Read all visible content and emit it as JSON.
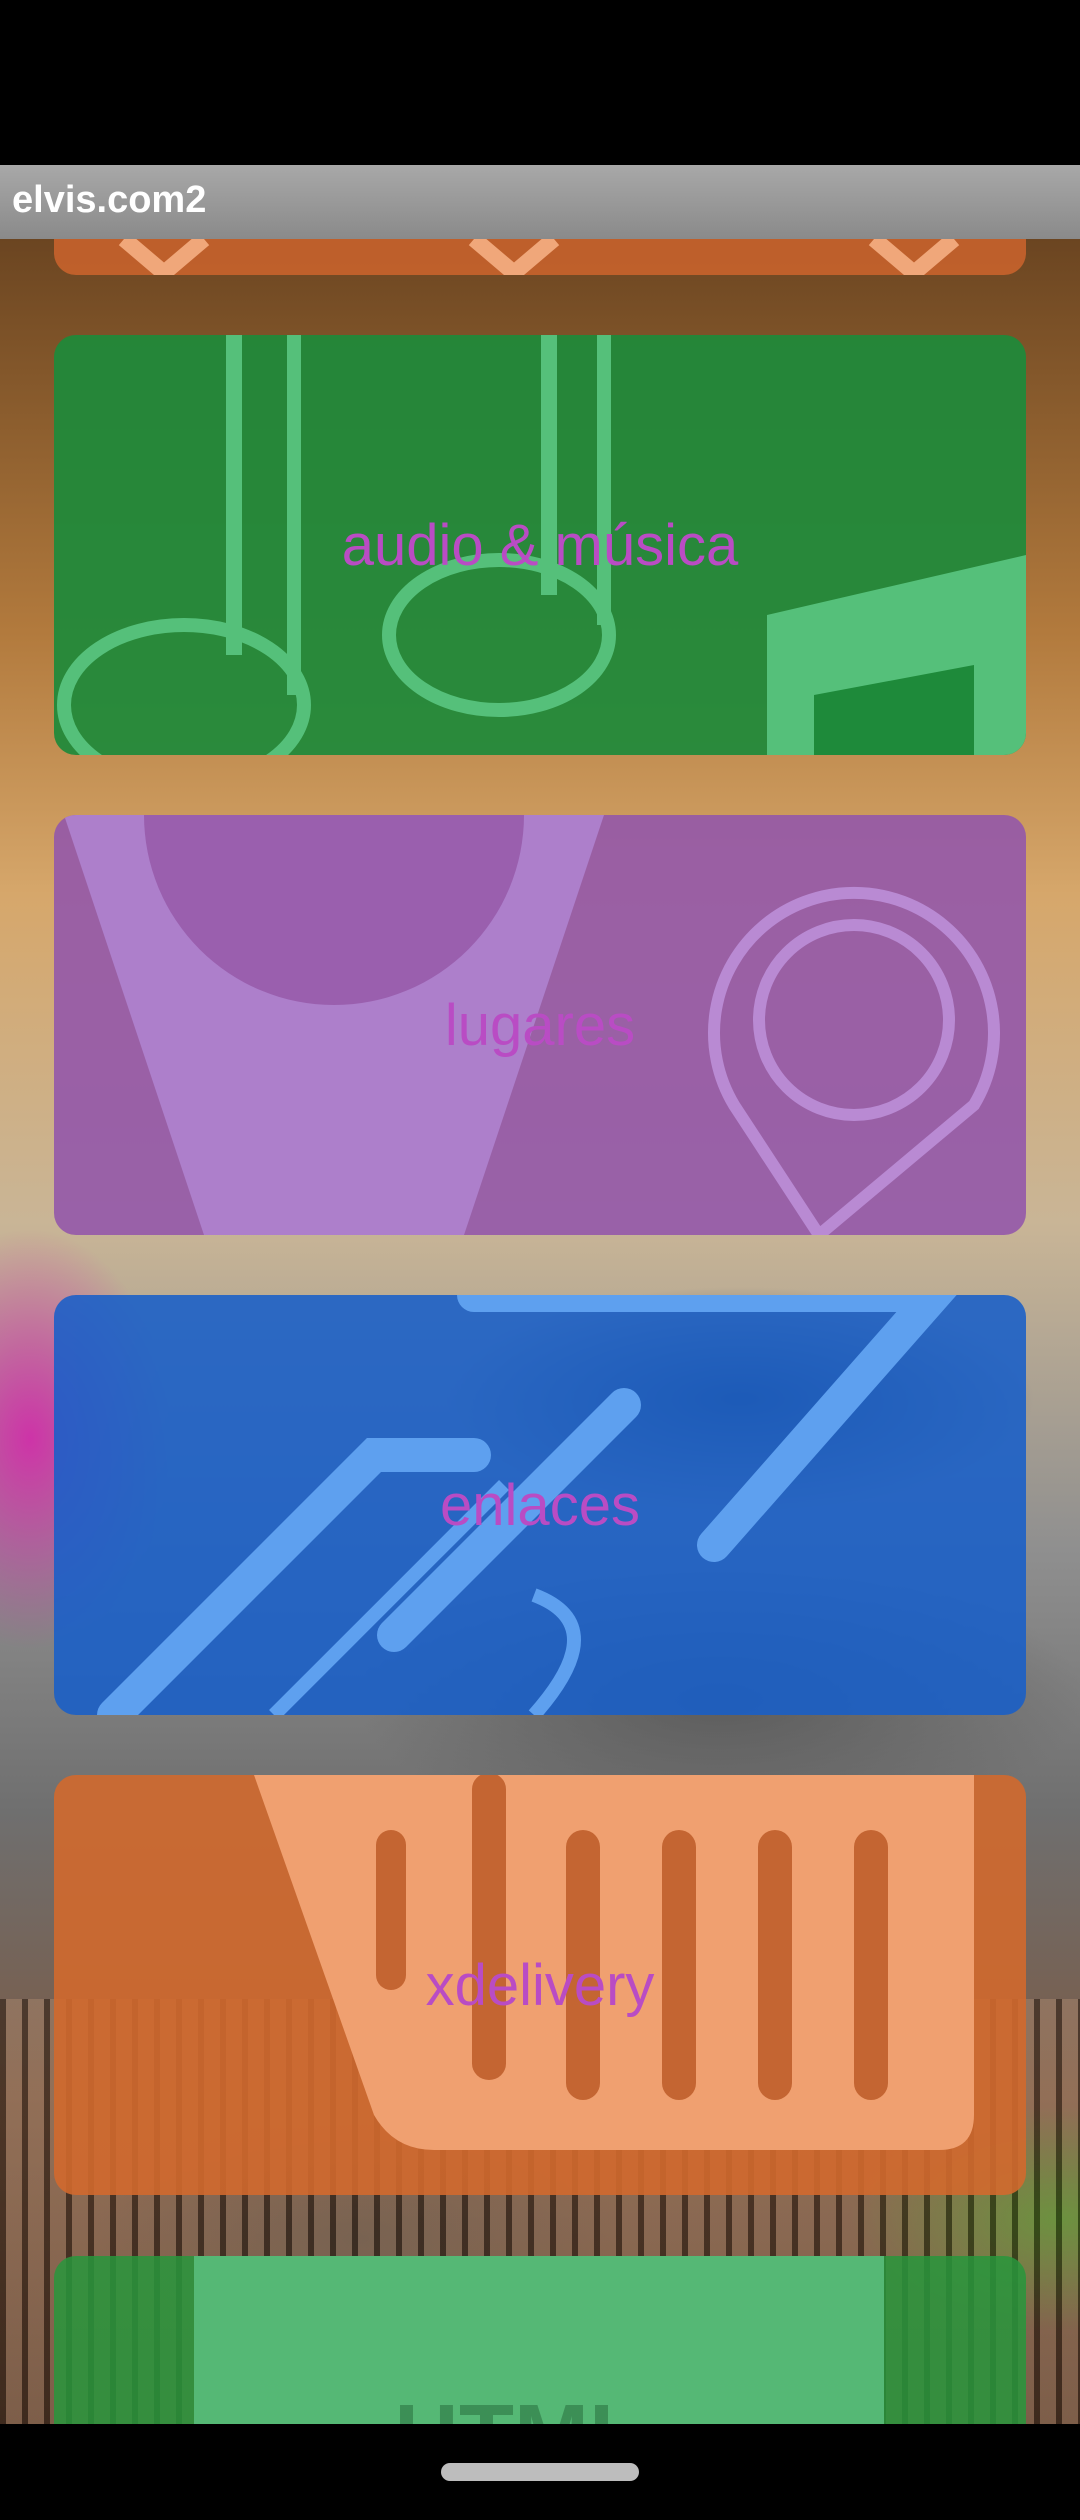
{
  "app_bar": {
    "title": "elvis.com2"
  },
  "cards": [
    {
      "label": "audio & música",
      "icon": "music-note-icon",
      "color": "#1e8a3a"
    },
    {
      "label": "lugares",
      "icon": "location-pin-icon",
      "color": "#9a5fae"
    },
    {
      "label": "enlaces",
      "icon": "link-icon",
      "color": "#1e63c8"
    },
    {
      "label": "xdelivery",
      "icon": "delivery-basket-icon",
      "color": "#d2692e"
    }
  ],
  "partial_bottom": {
    "label": "HTML"
  },
  "colors": {
    "label_text": "#b94cc4",
    "app_bar": "#9a9a9a"
  }
}
